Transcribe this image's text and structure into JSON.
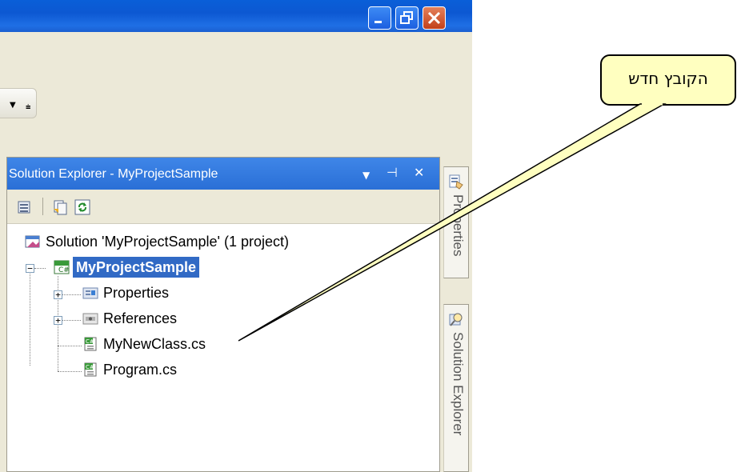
{
  "colors": {
    "titlebar": "#0a5fd8",
    "selection": "#316ac5",
    "callout_fill": "#ffffc0",
    "panel_bg": "#ece9d8"
  },
  "window": {
    "buttons": {
      "minimize_icon": "minimize-icon",
      "restore_icon": "restore-icon",
      "close_icon": "close-icon"
    }
  },
  "solution_explorer": {
    "title": "Solution Explorer - MyProjectSample",
    "header_icons": [
      "dropdown-arrow-icon",
      "pin-icon",
      "close-icon"
    ],
    "toolbar_icons": [
      "properties-page-icon",
      "show-all-files-icon",
      "refresh-icon"
    ],
    "tree": {
      "solution": "Solution 'MyProjectSample' (1 project)",
      "project": "MyProjectSample",
      "children": [
        {
          "label": "Properties",
          "expandable": true
        },
        {
          "label": "References",
          "expandable": true
        },
        {
          "label": "MyNewClass.cs",
          "expandable": false
        },
        {
          "label": "Program.cs",
          "expandable": false
        }
      ]
    }
  },
  "side_tabs": [
    {
      "label": "Properties",
      "icon": "properties-hand-icon"
    },
    {
      "label": "Solution Explorer",
      "icon": "solution-explorer-icon"
    }
  ],
  "callout": {
    "text": "הקובץ חדש"
  }
}
